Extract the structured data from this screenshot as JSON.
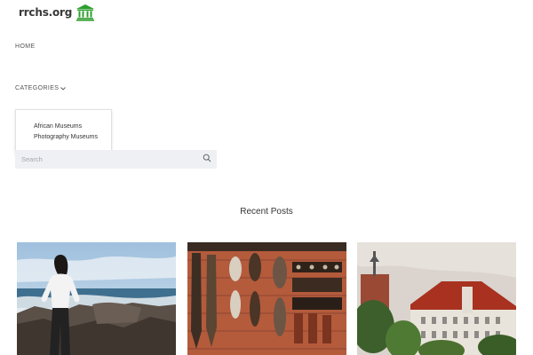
{
  "header": {
    "site_name": "rrchs.org",
    "logo_icon": "museum-building-icon",
    "brand_color": "#2e9e2e"
  },
  "nav": {
    "home_label": "HOME",
    "categories_label": "CATEGORIES",
    "categories_icon": "chevron-down-icon",
    "dropdown_items": [
      "African Museums",
      "Photography Museums"
    ]
  },
  "search": {
    "placeholder": "Search",
    "icon": "search-icon"
  },
  "recent_posts": {
    "title": "Recent Posts",
    "posts": [
      {
        "image": "woman-on-rocky-beach-photo"
      },
      {
        "image": "african-wooden-masks-wall-photo"
      },
      {
        "image": "red-roof-castle-building-photo"
      }
    ]
  }
}
